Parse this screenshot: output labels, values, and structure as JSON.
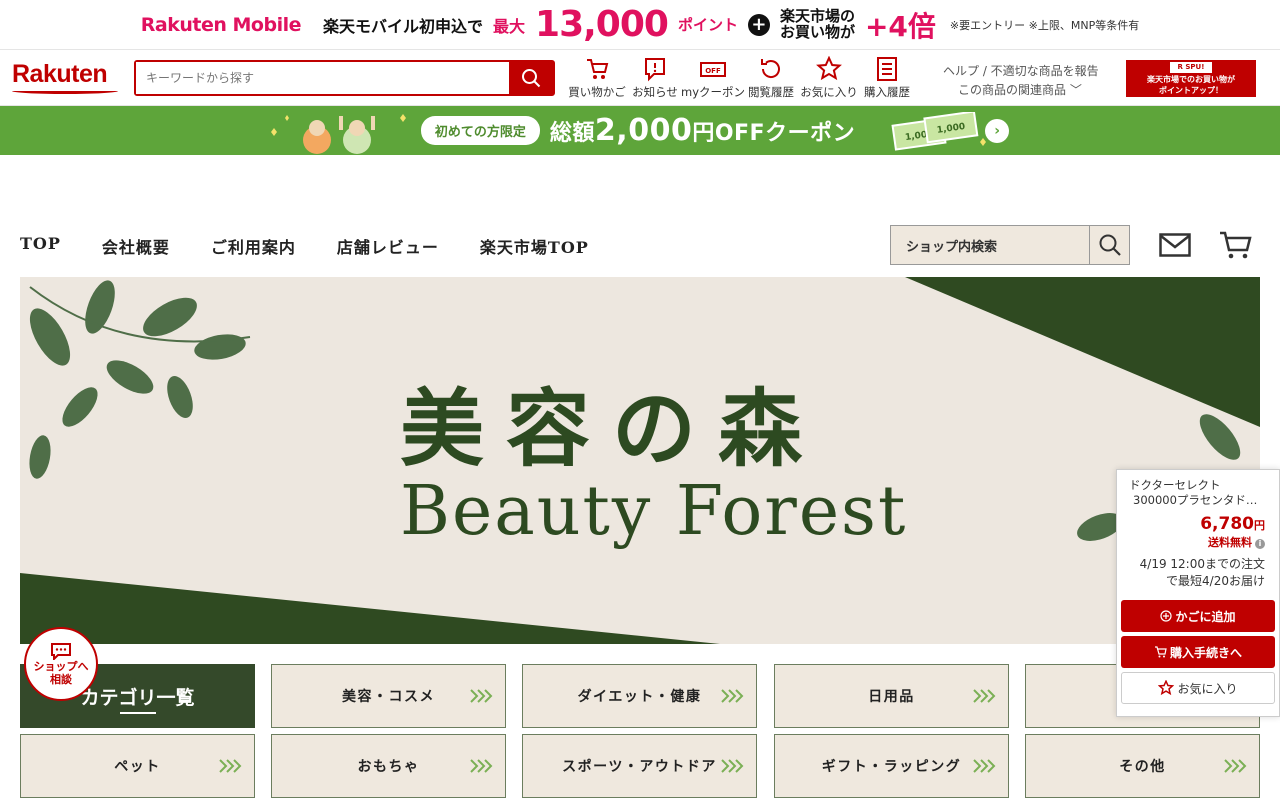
{
  "promo": {
    "brand": "Rakuten Mobile",
    "text1": "楽天モバイル初申込で",
    "pre": "最大",
    "points": "13,000",
    "points_unit": "ポイント",
    "plus": "+",
    "line_a": "楽天市場の",
    "line_b": "お買い物が",
    "times": "+4倍",
    "note": "※要エントリー ※上限、MNP等条件有"
  },
  "header": {
    "logo": "Rakuten",
    "search_placeholder": "キーワードから探す",
    "icons": [
      {
        "label": "買い物かご",
        "icon": "cart-icon"
      },
      {
        "label": "お知らせ",
        "icon": "notice-icon"
      },
      {
        "label": "myクーポン",
        "icon": "coupon-icon"
      },
      {
        "label": "閲覧履歴",
        "icon": "history-icon"
      },
      {
        "label": "お気に入り",
        "icon": "star-icon"
      },
      {
        "label": "購入履歴",
        "icon": "list-icon"
      }
    ],
    "help": "ヘルプ / 不適切な商品を報告",
    "related": "この商品の関連商品",
    "spu_tag": "R SPU!",
    "spu_line1": "楽天市場でのお買い物が",
    "spu_line2": "ポイントアップ！"
  },
  "coupon": {
    "pill": "初めての方限定",
    "text_pre": "総額",
    "amount": "2,000",
    "text_post": "円OFFクーポン",
    "bill1": "1,000",
    "bill2": "1,000"
  },
  "shopnav": {
    "items": [
      "TOP",
      "会社概要",
      "ご利用案内",
      "店舗レビュー",
      "楽天市場TOP"
    ],
    "search_label": "ショップ内検索"
  },
  "hero": {
    "title_jp": "美容の森",
    "title_en": "Beauty Forest"
  },
  "category": {
    "heading": "カテゴリ一覧",
    "items": [
      "美容・コスメ",
      "ダイエット・健康",
      "日用品",
      "",
      "ペット",
      "おもちゃ",
      "スポーツ・アウトドア",
      "ギフト・ラッピング",
      "その他"
    ]
  },
  "consult": {
    "line1": "ショップへ",
    "line2": "相談"
  },
  "panel": {
    "name_line1": "ドクターセレクト",
    "name_line2": "300000プラセンタドリ…",
    "price": "6,780",
    "price_unit": "円",
    "shipping": "送料無料",
    "delivery_line1": "4/19 12:00までの注文",
    "delivery_line2": "で最短4/20お届け",
    "add_to_cart": "かごに追加",
    "checkout": "購入手続きへ",
    "favorite": "お気に入り"
  },
  "colors": {
    "rakuten_red": "#bf0000",
    "promo_pink": "#e0115f",
    "coupon_green": "#5ea53a",
    "forest_green": "#34492a",
    "beige": "#ede7df"
  }
}
